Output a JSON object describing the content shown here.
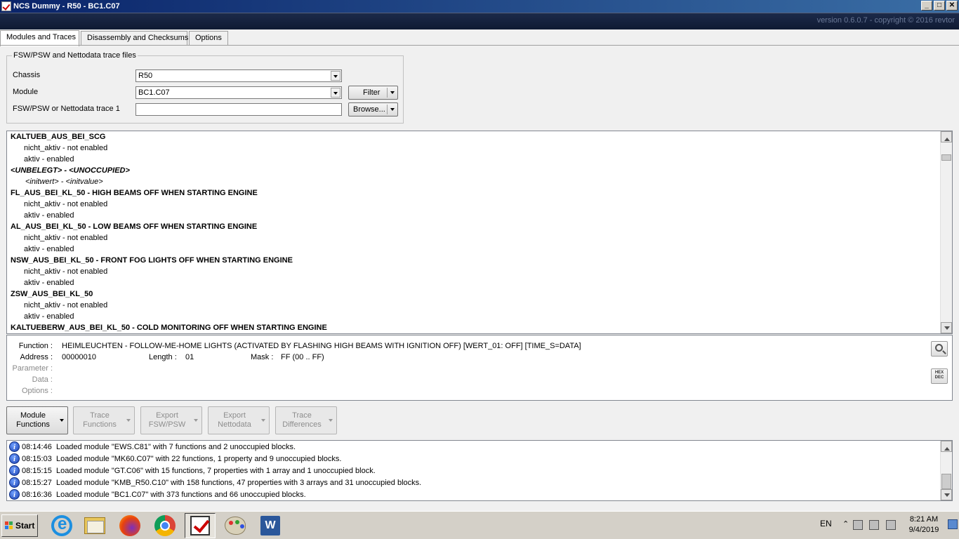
{
  "window": {
    "title": "NCS Dummy - R50 - BC1.C07",
    "version": "version 0.6.0.7 - copyright © 2016 revtor",
    "minimize": "_",
    "maximize": "□",
    "close": "✕"
  },
  "tabs": [
    {
      "label": "Modules and Traces"
    },
    {
      "label": "Disassembly and Checksums"
    },
    {
      "label": "Options"
    }
  ],
  "group": {
    "legend": "FSW/PSW and Nettodata trace files",
    "chassis_label": "Chassis",
    "chassis_value": "R50",
    "module_label": "Module",
    "module_value": "BC1.C07",
    "trace_label": "FSW/PSW or Nettodata trace 1",
    "trace_value": "",
    "filter_label": "Filter",
    "browse_label": "Browse..."
  },
  "tree": [
    {
      "text": "KALTUEB_AUS_BEI_SCG",
      "style": "b"
    },
    {
      "text": "nicht_aktiv  -  not enabled",
      "style": "ind"
    },
    {
      "text": "aktiv  -  enabled",
      "style": "ind"
    },
    {
      "text": "<UNBELEGT>  -  <UNOCCUPIED>",
      "style": "it"
    },
    {
      "text": "<initwert>  -  <initvalue>",
      "style": "ind2"
    },
    {
      "text": "FL_AUS_BEI_KL_50  -  HIGH BEAMS OFF WHEN STARTING ENGINE",
      "style": "b"
    },
    {
      "text": "nicht_aktiv  -  not enabled",
      "style": "ind"
    },
    {
      "text": "aktiv  -  enabled",
      "style": "ind"
    },
    {
      "text": "AL_AUS_BEI_KL_50  -  LOW BEAMS OFF WHEN STARTING ENGINE",
      "style": "b"
    },
    {
      "text": "nicht_aktiv  -  not enabled",
      "style": "ind"
    },
    {
      "text": "aktiv  -  enabled",
      "style": "ind"
    },
    {
      "text": "NSW_AUS_BEI_KL_50  -  FRONT FOG LIGHTS OFF WHEN STARTING ENGINE",
      "style": "b"
    },
    {
      "text": "nicht_aktiv  -  not enabled",
      "style": "ind"
    },
    {
      "text": "aktiv  -  enabled",
      "style": "ind"
    },
    {
      "text": "ZSW_AUS_BEI_KL_50",
      "style": "b"
    },
    {
      "text": "nicht_aktiv  -  not enabled",
      "style": "ind"
    },
    {
      "text": "aktiv  -  enabled",
      "style": "ind"
    },
    {
      "text": "KALTUEBERW_AUS_BEI_KL_50  -  COLD MONITORING OFF WHEN STARTING ENGINE",
      "style": "b"
    }
  ],
  "detail": {
    "function_label": "Function :",
    "function_value": "HEIMLEUCHTEN  -  FOLLOW-ME-HOME LIGHTS (ACTIVATED BY FLASHING HIGH BEAMS WITH IGNITION OFF) [WERT_01: OFF] [TIME_S=DATA]",
    "address_label": "Address :",
    "address_value": "00000010",
    "length_label": "Length :",
    "length_value": "01",
    "mask_label": "Mask :",
    "mask_value": "FF  (00 .. FF)",
    "parameter_label": "Parameter :",
    "data_label": "Data :",
    "options_label": "Options :",
    "hexdec_hex": "HEX",
    "hexdec_dec": "DEC"
  },
  "function_buttons": [
    {
      "line1": "Module",
      "line2": "Functions",
      "enabled": true
    },
    {
      "line1": "Trace",
      "line2": "Functions",
      "enabled": false
    },
    {
      "line1": "Export",
      "line2": "FSW/PSW",
      "enabled": false
    },
    {
      "line1": "Export",
      "line2": "Nettodata",
      "enabled": false
    },
    {
      "line1": "Trace",
      "line2": "Differences",
      "enabled": false
    }
  ],
  "log": [
    {
      "time": "08:14:46",
      "message": "Loaded module \"EWS.C81\" with 7 functions and 2 unoccupied blocks."
    },
    {
      "time": "08:15:03",
      "message": "Loaded module \"MK60.C07\" with 22 functions, 1 property and 9 unoccupied blocks."
    },
    {
      "time": "08:15:15",
      "message": "Loaded module \"GT.C06\" with 15 functions, 7 properties with 1 array and 1 unoccupied block."
    },
    {
      "time": "08:15:27",
      "message": "Loaded module \"KMB_R50.C10\" with 158 functions, 47 properties with 3 arrays and 31 unoccupied blocks."
    },
    {
      "time": "08:16:36",
      "message": "Loaded module \"BC1.C07\" with 373 functions and 66 unoccupied blocks."
    }
  ],
  "taskbar": {
    "start_label": "Start",
    "language": "EN",
    "time": "8:21 AM",
    "date": "9/4/2019",
    "word_letter": "W",
    "info_glyph": "i"
  },
  "colors": {
    "title_start": "#0a246a",
    "title_end": "#3a6ea5",
    "banner": "#1c2a4a",
    "version_text": "#6a7896"
  }
}
